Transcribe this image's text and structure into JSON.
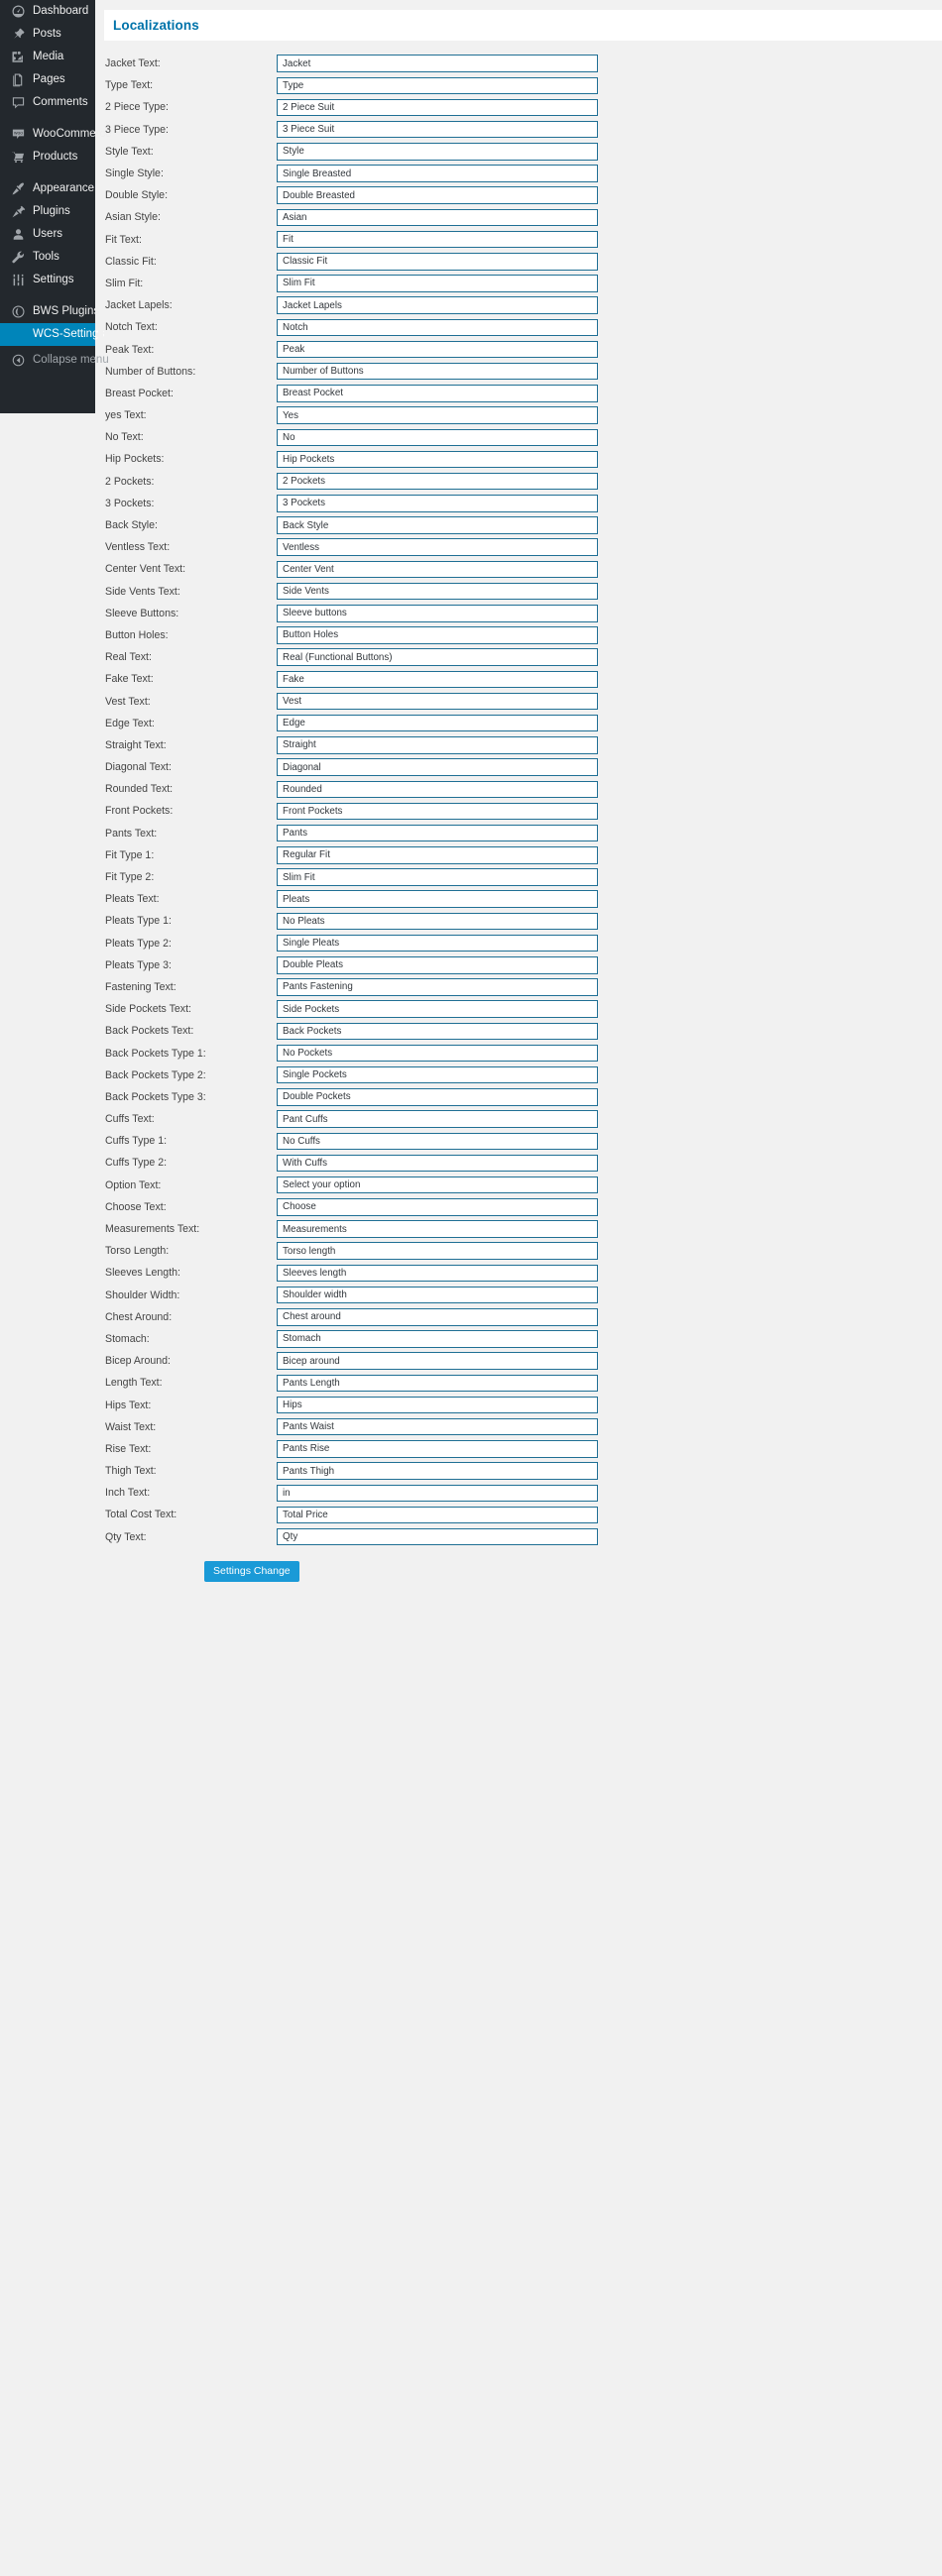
{
  "sidebar": {
    "items": [
      {
        "label": "Dashboard",
        "icon": "dashboard-icon",
        "type": "top"
      },
      {
        "label": "Posts",
        "icon": "pin-icon",
        "type": "top"
      },
      {
        "label": "Media",
        "icon": "media-icon",
        "type": "top"
      },
      {
        "label": "Pages",
        "icon": "pages-icon",
        "type": "top"
      },
      {
        "label": "Comments",
        "icon": "comments-icon",
        "type": "top"
      },
      {
        "label": "WooCommerce",
        "icon": "woocommerce-icon",
        "type": "top"
      },
      {
        "label": "Products",
        "icon": "cart-icon",
        "type": "top"
      },
      {
        "label": "Appearance",
        "icon": "brush-icon",
        "type": "top"
      },
      {
        "label": "Plugins",
        "icon": "plug-icon",
        "type": "top"
      },
      {
        "label": "Users",
        "icon": "user-icon",
        "type": "top"
      },
      {
        "label": "Tools",
        "icon": "wrench-icon",
        "type": "top"
      },
      {
        "label": "Settings",
        "icon": "sliders-icon",
        "type": "top"
      },
      {
        "label": "BWS Plugins",
        "icon": "bws-globe-icon",
        "type": "top"
      },
      {
        "label": "WCS-Settings",
        "icon": "none",
        "type": "sub",
        "current": true
      },
      {
        "label": "Collapse menu",
        "icon": "collapse-arrow-icon",
        "type": "collapse"
      }
    ]
  },
  "page": {
    "tab_title": "Localizations",
    "submit_label": "Settings Change"
  },
  "fields": [
    {
      "label": "Jacket Text:",
      "value": "Jacket"
    },
    {
      "label": "Type Text:",
      "value": "Type"
    },
    {
      "label": "2 Piece Type:",
      "value": "2 Piece Suit"
    },
    {
      "label": "3 Piece Type:",
      "value": "3 Piece Suit"
    },
    {
      "label": "Style Text:",
      "value": "Style"
    },
    {
      "label": "Single Style:",
      "value": "Single Breasted"
    },
    {
      "label": "Double Style:",
      "value": "Double Breasted"
    },
    {
      "label": "Asian Style:",
      "value": "Asian"
    },
    {
      "label": "Fit Text:",
      "value": "Fit"
    },
    {
      "label": "Classic Fit:",
      "value": "Classic Fit"
    },
    {
      "label": "Slim Fit:",
      "value": "Slim Fit"
    },
    {
      "label": "Jacket Lapels:",
      "value": "Jacket Lapels"
    },
    {
      "label": "Notch Text:",
      "value": "Notch"
    },
    {
      "label": "Peak Text:",
      "value": "Peak"
    },
    {
      "label": "Number of Buttons:",
      "value": "Number of Buttons"
    },
    {
      "label": "Breast Pocket:",
      "value": "Breast Pocket"
    },
    {
      "label": "yes Text:",
      "value": "Yes"
    },
    {
      "label": "No Text:",
      "value": "No"
    },
    {
      "label": "Hip Pockets:",
      "value": "Hip Pockets"
    },
    {
      "label": "2 Pockets:",
      "value": "2 Pockets"
    },
    {
      "label": "3 Pockets:",
      "value": "3 Pockets"
    },
    {
      "label": "Back Style:",
      "value": "Back Style"
    },
    {
      "label": "Ventless Text:",
      "value": "Ventless"
    },
    {
      "label": "Center Vent Text:",
      "value": "Center Vent"
    },
    {
      "label": "Side Vents Text:",
      "value": "Side Vents"
    },
    {
      "label": "Sleeve Buttons:",
      "value": "Sleeve buttons"
    },
    {
      "label": "Button Holes:",
      "value": "Button Holes"
    },
    {
      "label": "Real Text:",
      "value": "Real (Functional Buttons)"
    },
    {
      "label": "Fake Text:",
      "value": "Fake"
    },
    {
      "label": "Vest Text:",
      "value": "Vest"
    },
    {
      "label": "Edge Text:",
      "value": "Edge"
    },
    {
      "label": "Straight Text:",
      "value": "Straight"
    },
    {
      "label": "Diagonal Text:",
      "value": "Diagonal"
    },
    {
      "label": "Rounded Text:",
      "value": "Rounded"
    },
    {
      "label": "Front Pockets:",
      "value": "Front Pockets"
    },
    {
      "label": "Pants Text:",
      "value": "Pants"
    },
    {
      "label": "Fit Type 1:",
      "value": "Regular Fit"
    },
    {
      "label": "Fit Type 2:",
      "value": "Slim Fit"
    },
    {
      "label": "Pleats Text:",
      "value": "Pleats"
    },
    {
      "label": "Pleats Type 1:",
      "value": "No Pleats"
    },
    {
      "label": "Pleats Type 2:",
      "value": "Single Pleats"
    },
    {
      "label": "Pleats Type 3:",
      "value": "Double Pleats"
    },
    {
      "label": "Fastening Text:",
      "value": "Pants Fastening"
    },
    {
      "label": "Side Pockets Text:",
      "value": "Side Pockets"
    },
    {
      "label": "Back Pockets Text:",
      "value": "Back Pockets"
    },
    {
      "label": "Back Pockets Type 1:",
      "value": "No Pockets"
    },
    {
      "label": "Back Pockets Type 2:",
      "value": "Single Pockets"
    },
    {
      "label": "Back Pockets Type 3:",
      "value": "Double Pockets"
    },
    {
      "label": "Cuffs Text:",
      "value": "Pant Cuffs"
    },
    {
      "label": "Cuffs Type 1:",
      "value": "No Cuffs"
    },
    {
      "label": "Cuffs Type 2:",
      "value": "With Cuffs"
    },
    {
      "label": "Option Text:",
      "value": "Select your option"
    },
    {
      "label": "Choose Text:",
      "value": "Choose"
    },
    {
      "label": "Measurements Text:",
      "value": "Measurements"
    },
    {
      "label": "Torso Length:",
      "value": "Torso length"
    },
    {
      "label": "Sleeves Length:",
      "value": "Sleeves length"
    },
    {
      "label": "Shoulder Width:",
      "value": "Shoulder width"
    },
    {
      "label": "Chest Around:",
      "value": "Chest around"
    },
    {
      "label": "Stomach:",
      "value": "Stomach"
    },
    {
      "label": "Bicep Around:",
      "value": "Bicep around"
    },
    {
      "label": "Length Text:",
      "value": "Pants Length"
    },
    {
      "label": "Hips Text:",
      "value": "Hips"
    },
    {
      "label": "Waist Text:",
      "value": "Pants Waist"
    },
    {
      "label": "Rise Text:",
      "value": "Pants Rise"
    },
    {
      "label": "Thigh Text:",
      "value": "Pants Thigh"
    },
    {
      "label": "Inch Text:",
      "value": "in"
    },
    {
      "label": "Total Cost Text:",
      "value": "Total Price"
    },
    {
      "label": "Qty Text:",
      "value": "Qty"
    }
  ],
  "colors": {
    "sidebar_bg": "#23282d",
    "accent": "#0085ba",
    "tab_title": "#0073aa",
    "input_border": "#1f6f94",
    "button_bg": "#1a9ad7",
    "page_bg": "#f1f1f1"
  }
}
